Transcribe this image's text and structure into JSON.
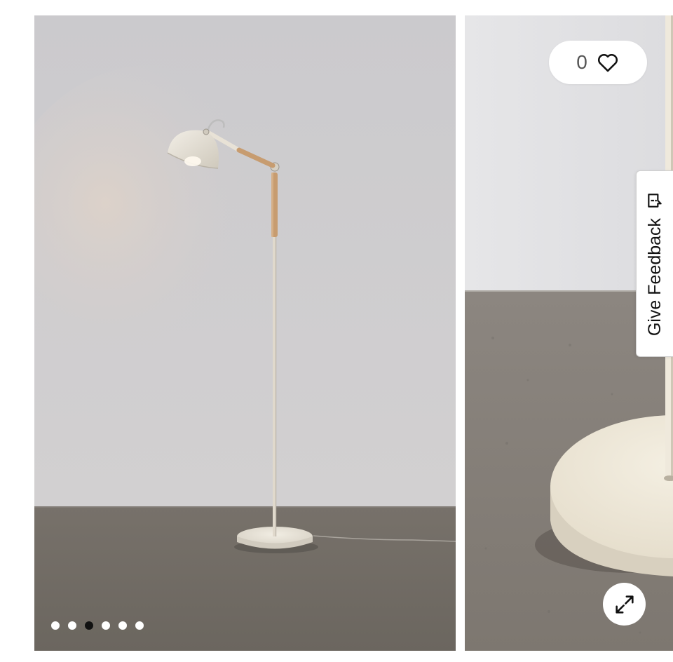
{
  "gallery": {
    "slides": [
      {
        "name": "floor-lamp-full-view",
        "type": "product-photo"
      },
      {
        "name": "floor-lamp-base-closeup",
        "type": "product-photo"
      }
    ],
    "active_slide_index": 2,
    "total_slides": 6,
    "colors": {
      "wall": "#cfcdcf",
      "floor": "#6f6a63",
      "lamp_cream": "#ede8dc",
      "wood": "#c79c70"
    }
  },
  "like": {
    "count": "0",
    "icon": "heart-icon"
  },
  "feedback": {
    "label": "Give Feedback",
    "icon": "feedback-icon"
  },
  "expand": {
    "icon": "expand-icon"
  }
}
